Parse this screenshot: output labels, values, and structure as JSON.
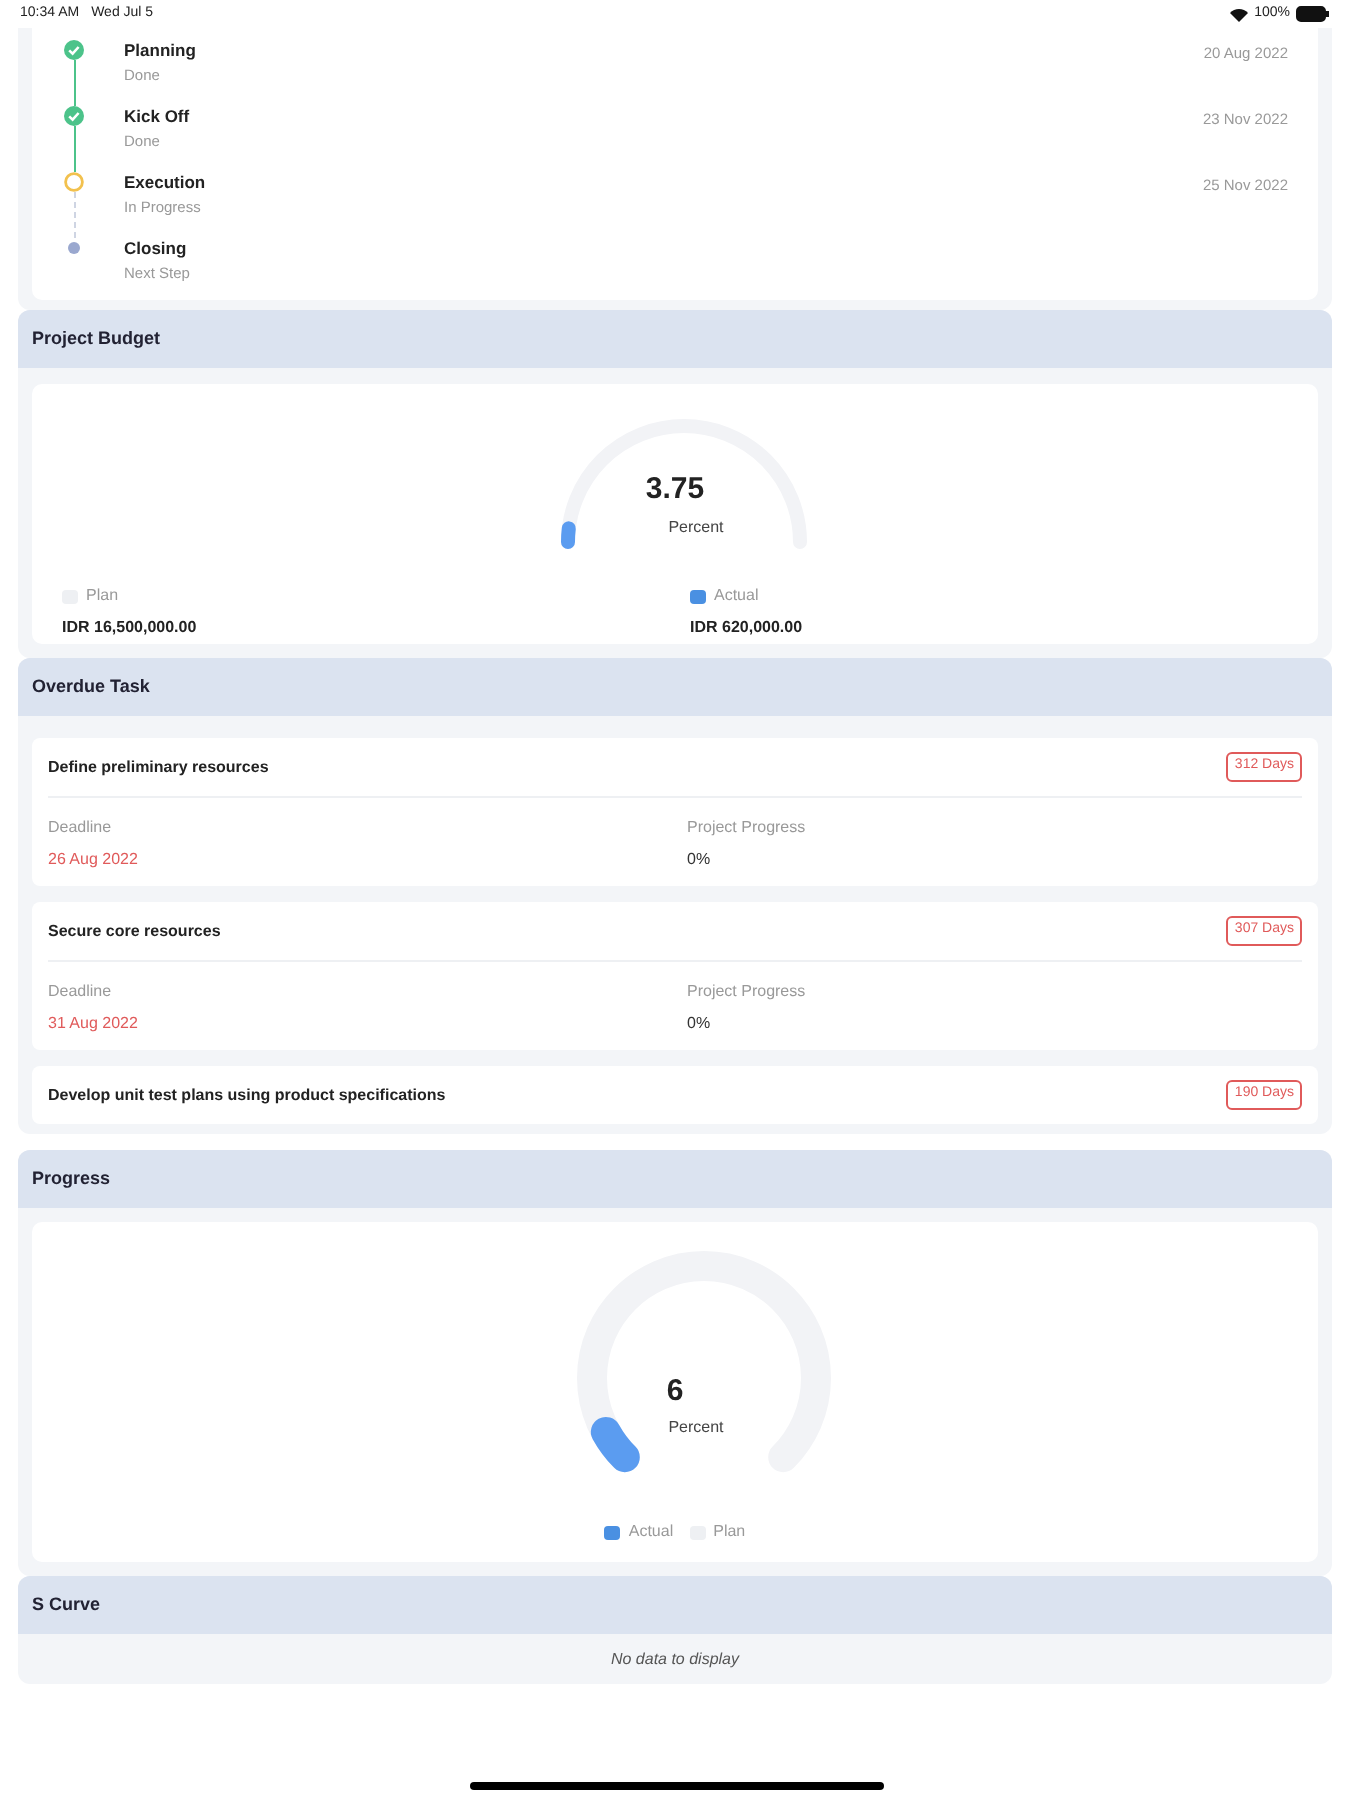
{
  "status_bar": {
    "time": "10:34 AM",
    "date": "Wed Jul 5",
    "battery": "100%"
  },
  "timeline": [
    {
      "title": "Planning",
      "status": "Done",
      "kind": "done",
      "date": "20 Aug 2022"
    },
    {
      "title": "Kick Off",
      "status": "Done",
      "kind": "done",
      "date": "23 Nov 2022"
    },
    {
      "title": "Execution",
      "status": "In Progress",
      "kind": "in_progress",
      "date": "25 Nov 2022"
    },
    {
      "title": "Closing",
      "status": "Next Step",
      "kind": "next"
    }
  ],
  "budget": {
    "title": "Project Budget",
    "value": "3.75",
    "unit": "Percent",
    "level": 0.0375,
    "legend": [
      {
        "label": "Plan",
        "amount": "IDR 16,500,000.00",
        "color": "#eef0f3"
      },
      {
        "label": "Actual",
        "amount": "IDR 620,000.00",
        "color": "#4a90e2"
      }
    ]
  },
  "overdue": {
    "title": "Overdue Task",
    "tasks": [
      {
        "name": "Define preliminary resources",
        "days": "312 Days",
        "deadline_label": "Deadline",
        "deadline": "26 Aug 2022",
        "progress_label": "Project Progress",
        "progress": "0%"
      },
      {
        "name": "Secure core resources",
        "days": "307 Days",
        "deadline_label": "Deadline",
        "deadline": "31 Aug 2022",
        "progress_label": "Project Progress",
        "progress": "0%"
      },
      {
        "name": "Develop unit test plans using product specifications",
        "days": "190 Days"
      }
    ]
  },
  "progress": {
    "title": "Progress",
    "value": "6",
    "unit": "Percent",
    "level": 0.06,
    "legend": [
      {
        "label": "Actual",
        "color": "#4a90e2"
      },
      {
        "label": "Plan",
        "color": "#eef0f3"
      }
    ]
  },
  "s_curve": {
    "title": "S Curve",
    "empty": "No data to display"
  }
}
